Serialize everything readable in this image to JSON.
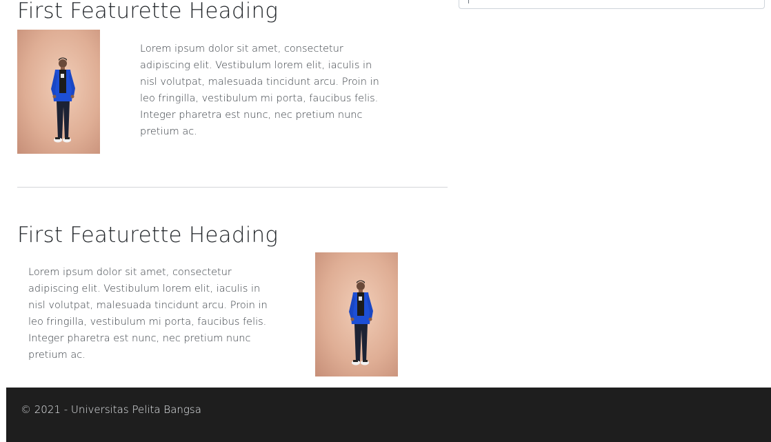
{
  "featurettes": [
    {
      "heading": "First Featurette Heading",
      "text": "Lorem ipsum dolor sit amet, consectetur adipiscing elit. Vestibulum lorem elit, iaculis in nisl volutpat, malesuada tincidunt arcu. Proin in leo fringilla, vestibulum mi porta, faucibus felis. Integer pharetra est nunc, nec pretium nunc pretium ac."
    },
    {
      "heading": "First Featurette Heading",
      "text": "Lorem ipsum dolor sit amet, consectetur adipiscing elit. Vestibulum lorem elit, iaculis in nisl volutpat, malesuada tincidunt arcu. Proin in leo fringilla, vestibulum mi porta, faucibus felis. Integer pharetra est nunc, nec pretium nunc pretium ac."
    }
  ],
  "footer": {
    "copyright": "© 2021 - Universitas Pelita Bangsa"
  },
  "colors": {
    "footer_bg": "#1e1e1e",
    "jacket": "#1d4fd6",
    "photo_bg": "#e0b39b"
  }
}
